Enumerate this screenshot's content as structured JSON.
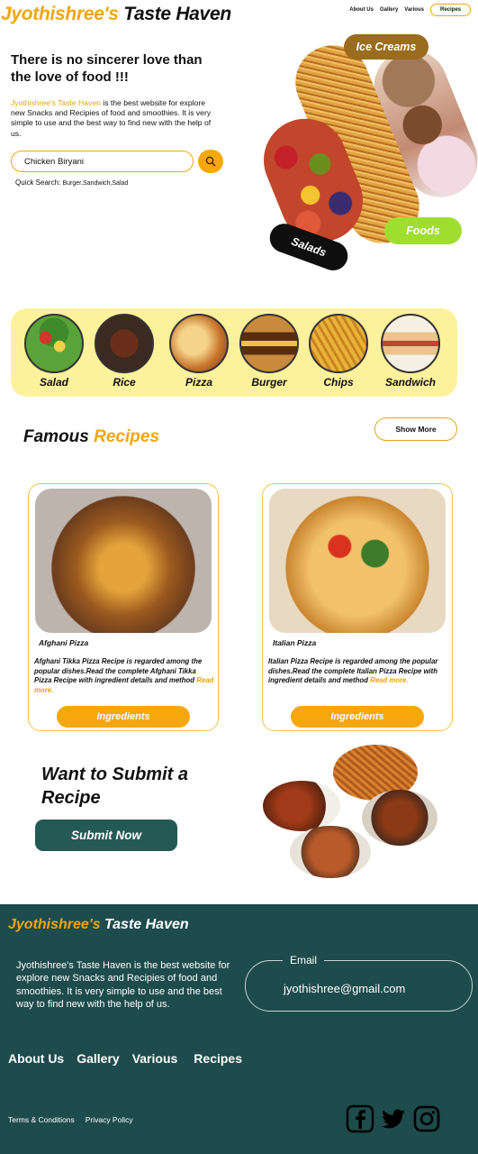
{
  "header": {
    "brand_part1": "Jyothishree's",
    "brand_part2": "Taste Haven",
    "nav": [
      "About Us",
      "Gallery",
      "Various",
      "Recipes"
    ]
  },
  "hero": {
    "title": "There is no sincerer love than the love of food !!!",
    "desc_highlight": "Jyothishree's Taste Haven",
    "desc_rest": "is the best website for explore new Snacks and Recipies of food and smoothies. It is very simple to use and the best way to find new with the help of us.",
    "search_value": "Chicken Biryani",
    "quick_label": "Quick Search:",
    "quick_items": "Burger,Sandwich,Salad",
    "tags": {
      "ice_creams": "Ice Creams",
      "foods": "Foods",
      "salads": "Salads"
    }
  },
  "categories": [
    "Salad",
    "Rice",
    "Pizza",
    "Burger",
    "Chips",
    "Sandwich"
  ],
  "famous": {
    "title_part1": "Famous",
    "title_part2": "Recipes",
    "show_more": "Show More",
    "cards": [
      {
        "name": "Afghani Pizza",
        "desc": "Afghani Tikka Pizza Recipe is regarded among the popular dishes.Read the complete Afghani Tikka Pizza Recipe with ingredient details and method",
        "read_more": "Read more.",
        "button": "Ingredients"
      },
      {
        "name": "Italian Pizza",
        "desc": "Italian Pizza Recipe is regarded among the popular dishes.Read the complete Italian Pizza Recipe with ingredient details and method",
        "read_more": "Read more.",
        "button": "Ingredients"
      }
    ]
  },
  "submit": {
    "title": "Want to Submit a Recipe",
    "button": "Submit Now"
  },
  "footer": {
    "brand_part1": "Jyothishree's",
    "brand_part2": "Taste Haven",
    "desc": "Jyothishree's Taste Haven is the best website for explore new Snacks and Recipies of food and smoothies. It is very simple to use and the best way to find new with the help of us.",
    "email_label": "Email",
    "email": "jyothishree@gmail.com",
    "links": [
      "About Us",
      "Gallery",
      "Various",
      "Recipes"
    ],
    "legal": [
      "Terms & Conditions",
      "Privacy Policy"
    ],
    "social_icons": [
      "facebook-icon",
      "twitter-icon",
      "instagram-icon"
    ]
  },
  "colors": {
    "accent": "#f6a70c",
    "footer_bg": "#1e4b4b",
    "category_bg": "#fdf19b",
    "submit_btn": "#245a55",
    "foods_tag": "#9fde2f"
  }
}
